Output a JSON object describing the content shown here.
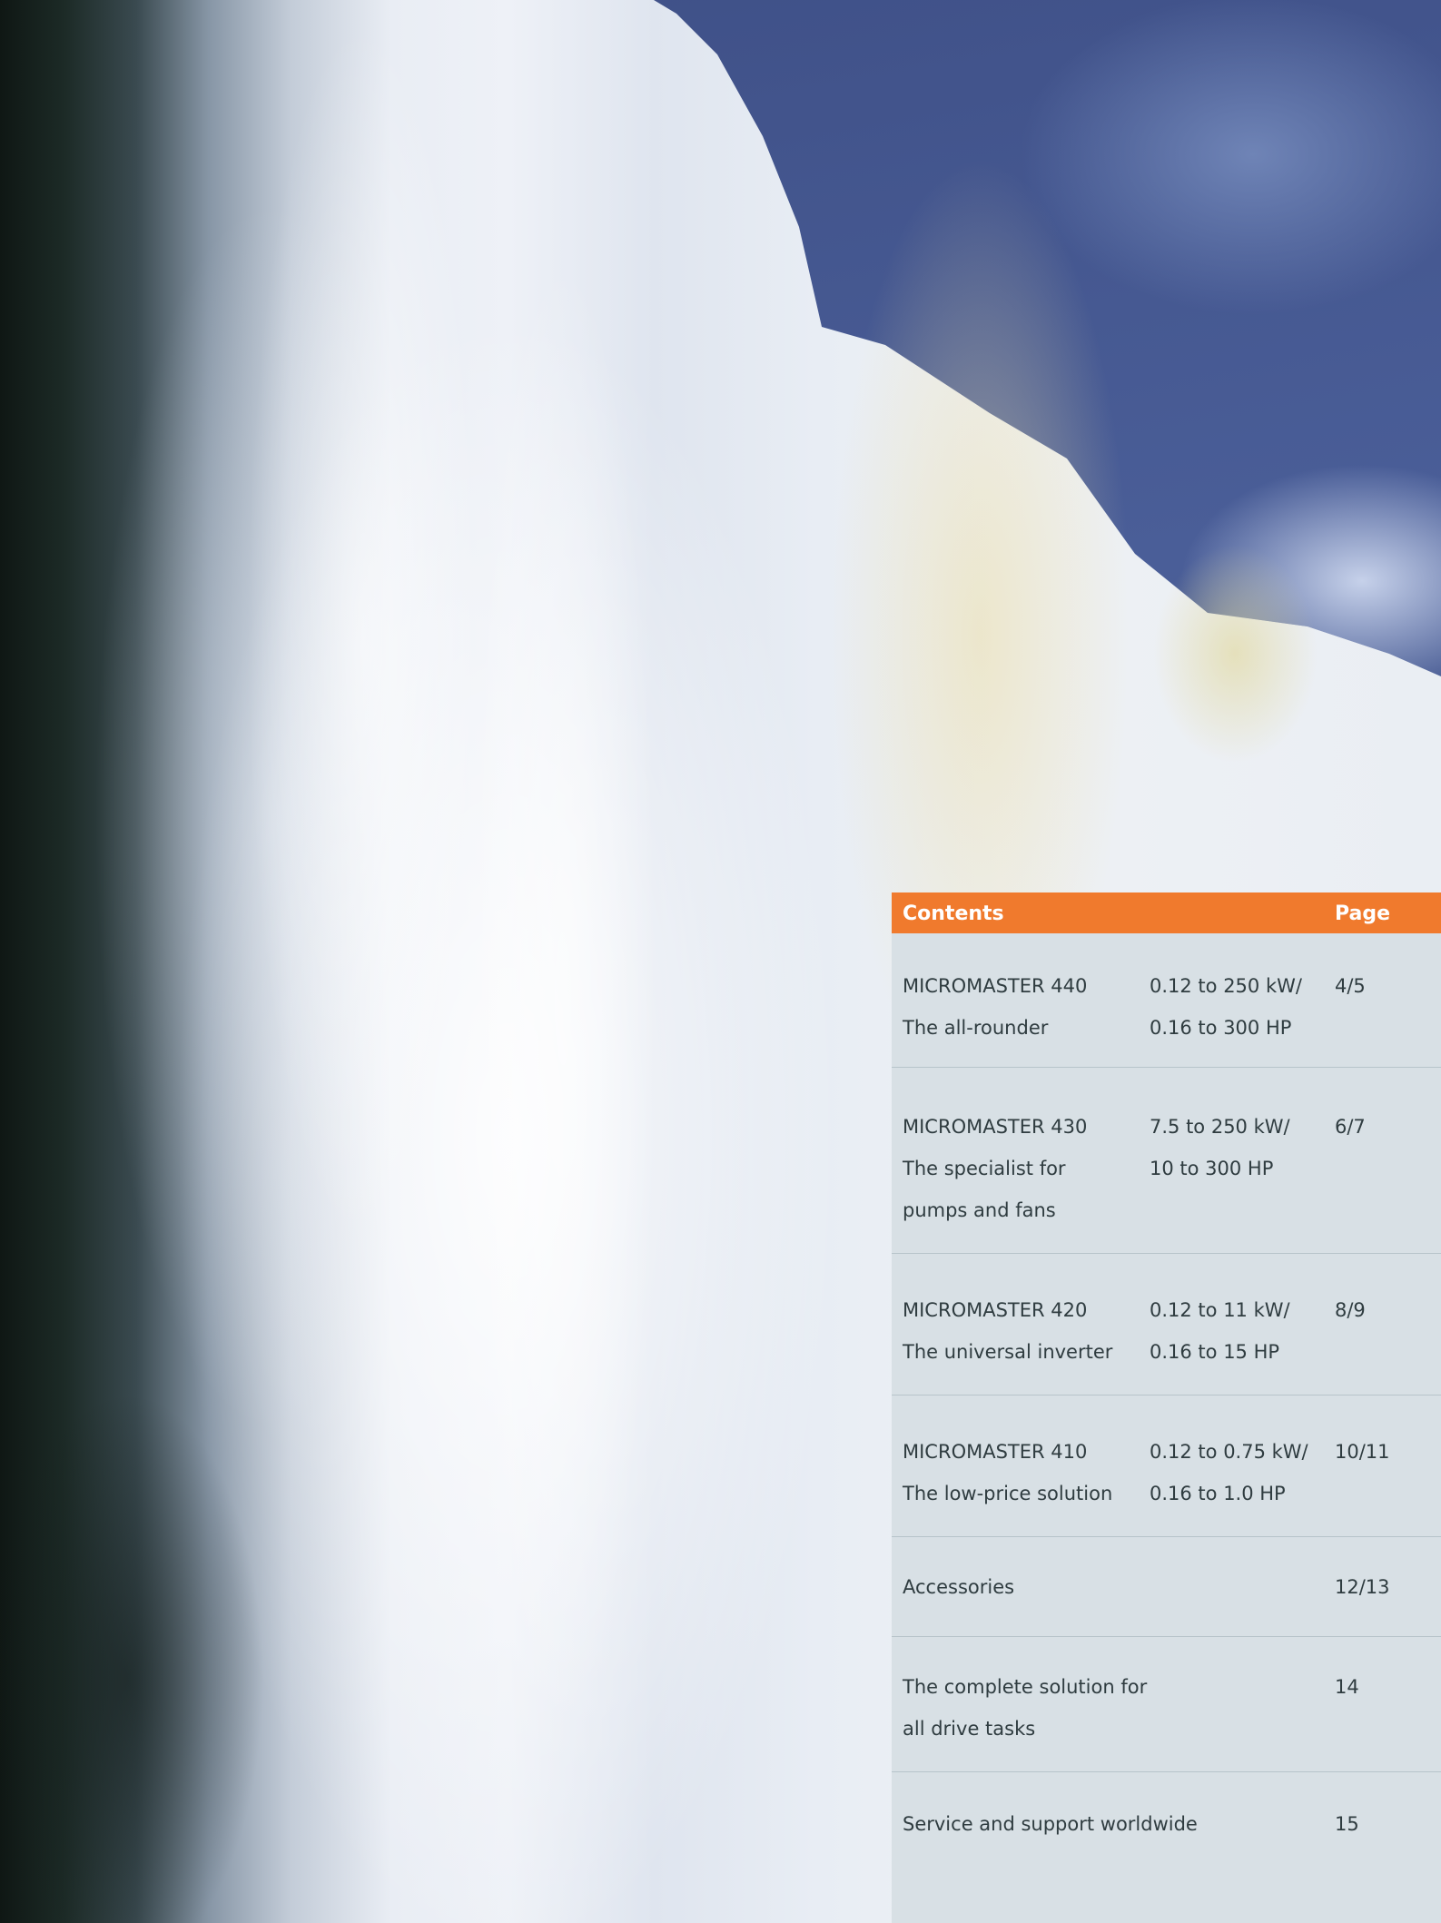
{
  "contents": {
    "title": "Contents",
    "page_heading": "Page",
    "accent_color": "#f07a2d",
    "entries": [
      {
        "name_line1": "MICROMASTER 440",
        "name_line2": "The all-rounder",
        "name_line3": "",
        "range_line1": "0.12 to 250 kW/",
        "range_line2": "0.16 to 300 HP",
        "page": "4/5"
      },
      {
        "name_line1": "MICROMASTER 430",
        "name_line2": "The specialist for",
        "name_line3": "pumps and fans",
        "range_line1": "7.5 to 250 kW/",
        "range_line2": "10 to 300 HP",
        "page": "6/7"
      },
      {
        "name_line1": "MICROMASTER 420",
        "name_line2": "The universal inverter",
        "name_line3": "",
        "range_line1": "0.12 to 11 kW/",
        "range_line2": "0.16 to 15 HP",
        "page": "8/9"
      },
      {
        "name_line1": "MICROMASTER 410",
        "name_line2": "The low-price solution",
        "name_line3": "",
        "range_line1": "0.12 to 0.75 kW/",
        "range_line2": "0.16 to 1.0 HP",
        "page": "10/11"
      },
      {
        "name_line1": "Accessories",
        "name_line2": "",
        "name_line3": "",
        "range_line1": "",
        "range_line2": "",
        "page": "12/13"
      },
      {
        "name_line1": "The complete solution for",
        "name_line2": "all drive tasks",
        "name_line3": "",
        "range_line1": "",
        "range_line2": "",
        "page": "14"
      },
      {
        "name_line1": "Service and support worldwide",
        "name_line2": "",
        "name_line3": "",
        "range_line1": "",
        "range_line2": "",
        "page": "15"
      }
    ]
  }
}
